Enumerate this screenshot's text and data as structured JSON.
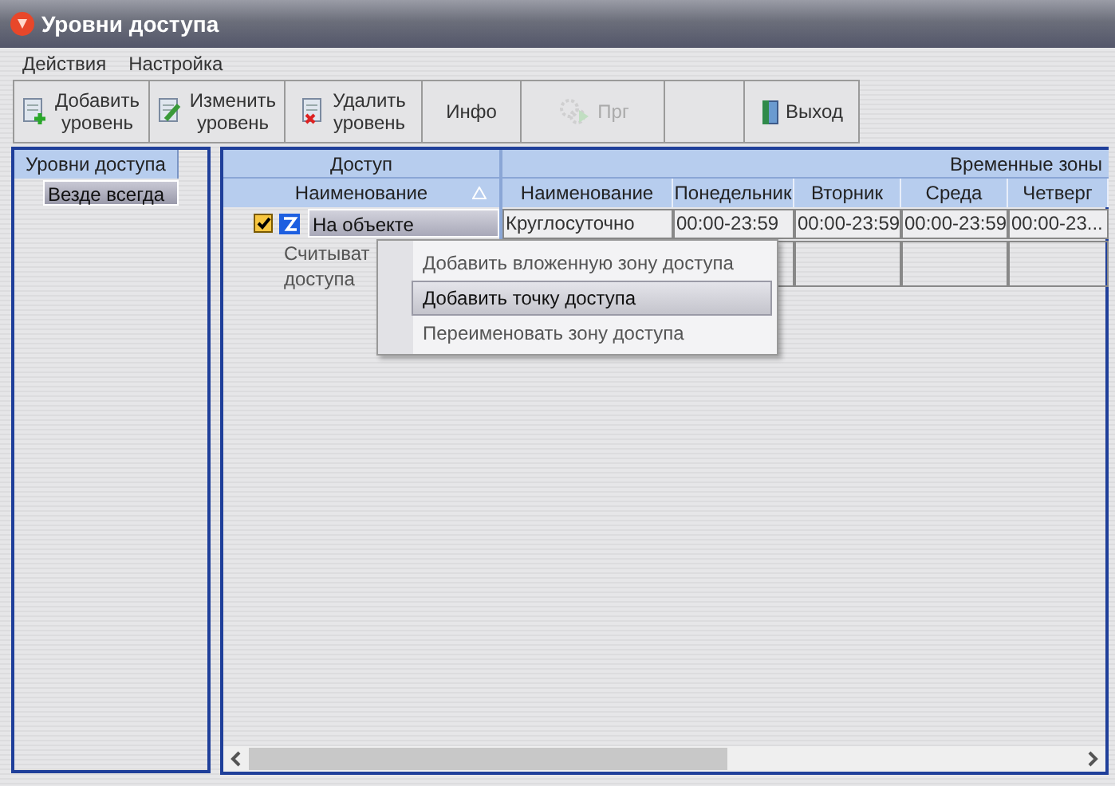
{
  "window": {
    "title": "Уровни доступа"
  },
  "menu": [
    "Действия",
    "Настройка"
  ],
  "toolbar": [
    {
      "kind": "add",
      "lines": [
        "Добавить",
        "уровень"
      ],
      "disabled": false
    },
    {
      "kind": "edit",
      "lines": [
        "Изменить",
        "уровень"
      ],
      "disabled": false
    },
    {
      "kind": "delete",
      "lines": [
        "Удалить",
        "уровень"
      ],
      "disabled": false
    },
    {
      "kind": "text",
      "lines": [
        "Инфо"
      ],
      "disabled": false
    },
    {
      "kind": "gears",
      "lines": [
        "Прг"
      ],
      "disabled": true
    },
    {
      "kind": "blank"
    },
    {
      "kind": "door",
      "lines": [
        "Выход"
      ],
      "disabled": false
    }
  ],
  "levels": {
    "header": "Уровни доступа",
    "items": [
      {
        "label": "Везде всегда",
        "selected": true
      }
    ]
  },
  "access": {
    "group_header": "Доступ",
    "column": "Наименование",
    "tree": [
      {
        "label": "На объекте",
        "checked": true,
        "selected": true,
        "children": [
          {
            "lines": [
              "Считыват",
              "доступа"
            ]
          }
        ]
      }
    ]
  },
  "time_zones": {
    "header": "Временные зоны",
    "columns": [
      "Наименование",
      "Понедельник",
      "Вторник",
      "Среда",
      "Четверг"
    ],
    "rows": [
      [
        "Круглосуточно",
        "00:00-23:59",
        "00:00-23:59",
        "00:00-23:59",
        "00:00-23..."
      ]
    ]
  },
  "context_menu": [
    {
      "label": "Добавить вложенную зону доступа",
      "selected": false
    },
    {
      "label": "Добавить точку доступа",
      "selected": true
    },
    {
      "label": "Переименовать зону доступа",
      "selected": false
    }
  ]
}
